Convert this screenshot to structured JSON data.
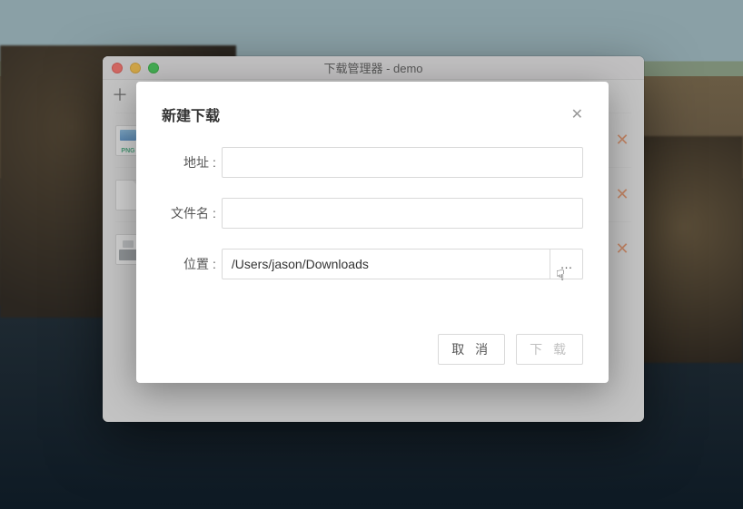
{
  "window": {
    "title": "下载管理器 - demo"
  },
  "toolbar": {
    "add_glyph": "＋"
  },
  "list": {
    "items": [
      {
        "kind": "png",
        "ext_label": "PNG"
      },
      {
        "kind": "generic"
      },
      {
        "kind": "dmg"
      }
    ],
    "delete_glyph": "✕"
  },
  "dialog": {
    "title": "新建下载",
    "close_glyph": "✕",
    "fields": {
      "url": {
        "label": "地址",
        "value": ""
      },
      "filename": {
        "label": "文件名",
        "value": ""
      },
      "location": {
        "label": "位置",
        "value": "/Users/jason/Downloads",
        "browse_glyph": "…"
      }
    },
    "actions": {
      "cancel": "取 消",
      "download": "下 载",
      "download_enabled": false
    }
  }
}
